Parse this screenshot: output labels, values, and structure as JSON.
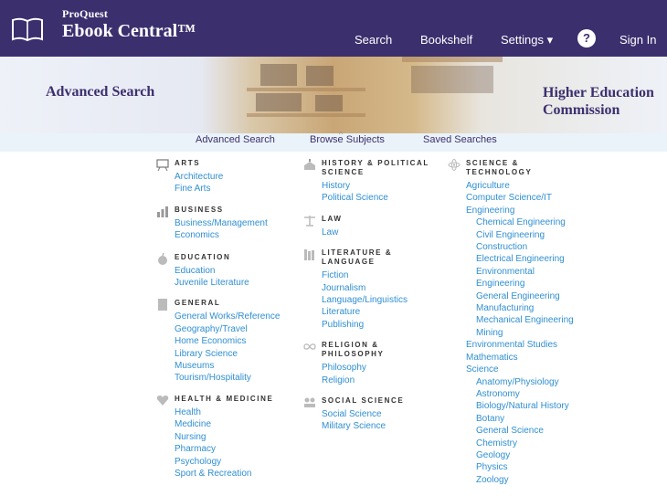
{
  "header": {
    "brand_small": "ProQuest",
    "brand_large": "Ebook Central™",
    "nav": {
      "search": "Search",
      "bookshelf": "Bookshelf",
      "settings": "Settings ▾",
      "help": "?",
      "signin": "Sign In"
    }
  },
  "banner": {
    "left": "Advanced Search",
    "right_line1": "Higher Education",
    "right_line2": "Commission"
  },
  "subnav": {
    "advanced": "Advanced Search",
    "browse": "Browse Subjects",
    "saved": "Saved Searches"
  },
  "col1": {
    "arts": {
      "title": "ARTS",
      "links": [
        "Architecture",
        "Fine Arts"
      ]
    },
    "business": {
      "title": "BUSINESS",
      "links": [
        "Business/Management",
        "Economics"
      ]
    },
    "education": {
      "title": "EDUCATION",
      "links": [
        "Education",
        "Juvenile Literature"
      ]
    },
    "general": {
      "title": "GENERAL",
      "links": [
        "General Works/Reference",
        "Geography/Travel",
        "Home Economics",
        "Library Science",
        "Museums",
        "Tourism/Hospitality"
      ]
    },
    "health": {
      "title": "HEALTH & MEDICINE",
      "links": [
        "Health",
        "Medicine",
        "Nursing",
        "Pharmacy",
        "Psychology",
        "Sport & Recreation"
      ]
    }
  },
  "col2": {
    "history": {
      "title1": "HISTORY & POLITICAL",
      "title2": "SCIENCE",
      "links": [
        "History",
        "Political Science"
      ]
    },
    "law": {
      "title": "LAW",
      "links": [
        "Law"
      ]
    },
    "literature": {
      "title1": "LITERATURE &",
      "title2": "LANGUAGE",
      "links": [
        "Fiction",
        "Journalism",
        "Language/Linguistics",
        "Literature",
        "Publishing"
      ]
    },
    "religion": {
      "title1": "RELIGION &",
      "title2": "PHILOSOPHY",
      "links": [
        "Philosophy",
        "Religion"
      ]
    },
    "social": {
      "title": "SOCIAL SCIENCE",
      "links": [
        "Social Science",
        "Military Science"
      ]
    }
  },
  "col3": {
    "science": {
      "title1": "SCIENCE &",
      "title2": "TECHNOLOGY",
      "top": [
        "Agriculture",
        "Computer Science/IT",
        "Engineering"
      ],
      "engineering": [
        "Chemical Engineering",
        "Civil Engineering",
        "Construction",
        "Electrical Engineering",
        "Environmental",
        "Engineering",
        "General Engineering",
        "Manufacturing",
        "Mechanical Engineering",
        "Mining"
      ],
      "mid": [
        "Environmental Studies",
        "Mathematics",
        "Science"
      ],
      "science_sub": [
        "Anatomy/Physiology",
        "Astronomy",
        "Biology/Natural History",
        "Botany",
        "General Science",
        "Chemistry",
        "Geology",
        "Physics",
        "Zoology"
      ]
    }
  },
  "colors": {
    "header_bg": "#3c2f6e",
    "link": "#2f8fd2",
    "subnav_bg": "#eaf3fa"
  }
}
